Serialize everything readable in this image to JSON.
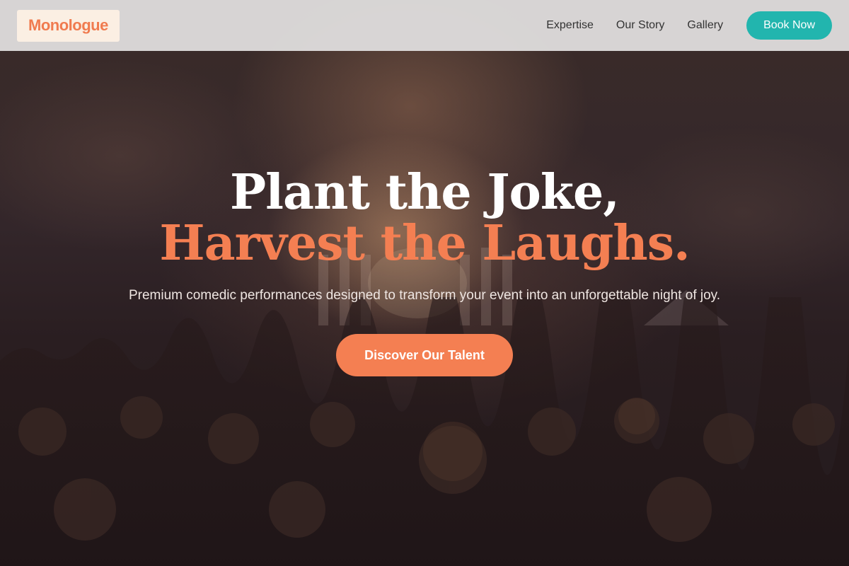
{
  "brand": {
    "name": "Monologue",
    "accent": "#f47f52",
    "teal": "#22b5ae"
  },
  "nav": {
    "links": [
      {
        "label": "Expertise"
      },
      {
        "label": "Our Story"
      },
      {
        "label": "Gallery"
      }
    ],
    "book_label": "Book Now"
  },
  "hero": {
    "headline_line1": "Plant the Joke,",
    "headline_line2": "Harvest the Laughs.",
    "subtitle": "Premium comedic performances designed to transform your event into an unforgettable night of joy.",
    "cta_label": "Discover Our Talent",
    "background": "concert-crowd-image"
  }
}
